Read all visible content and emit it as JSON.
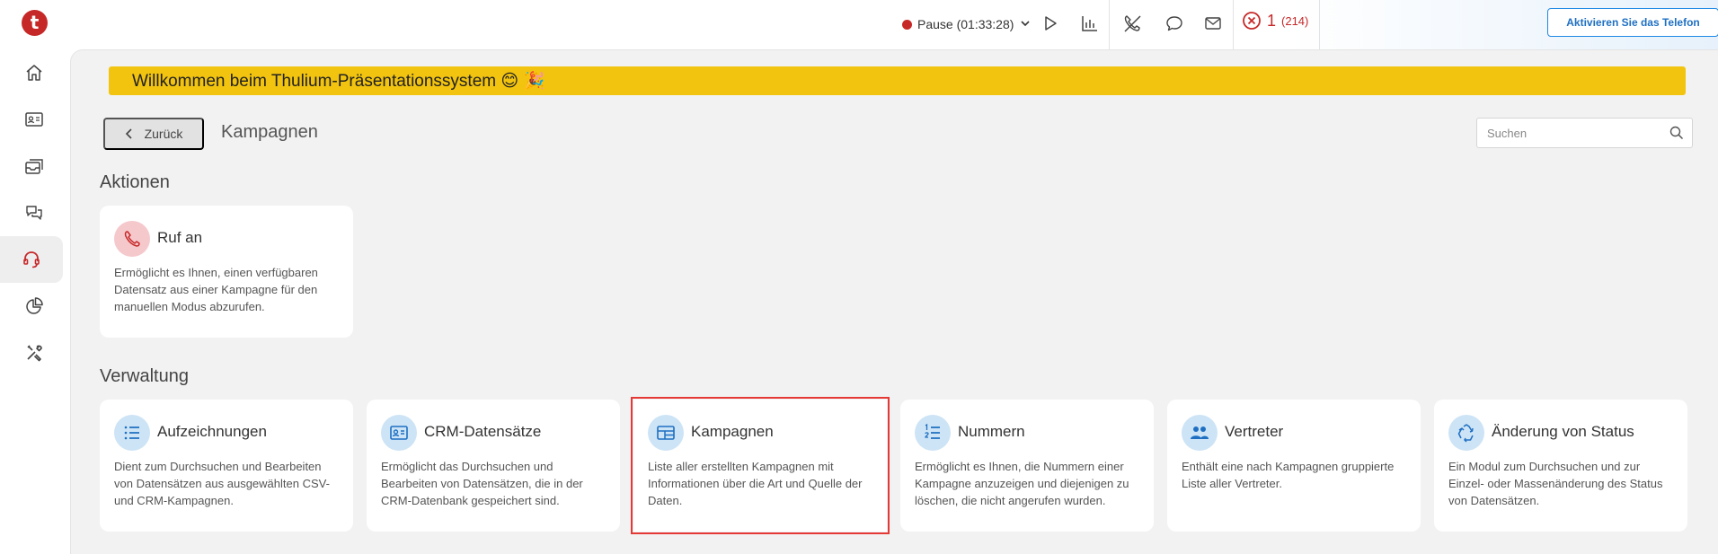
{
  "topbar": {
    "logo_letter": "t",
    "status_label": "Pause (01:33:28)",
    "error_count": "1",
    "error_total": "(214)",
    "activate_label": "Aktivieren Sie das Telefon"
  },
  "banner": {
    "text": "Willkommen beim Thulium-Präsentationssystem 😊 🎉"
  },
  "header": {
    "back_label": "Zurück",
    "title": "Kampagnen",
    "search_placeholder": "Suchen"
  },
  "sections": {
    "actions_title": "Aktionen",
    "management_title": "Verwaltung"
  },
  "actions": [
    {
      "title": "Ruf an",
      "desc": "Ermöglicht es Ihnen, einen verfügbaren Datensatz aus einer Kampagne für den manuellen Modus abzurufen.",
      "icon": "phone-icon"
    }
  ],
  "management": [
    {
      "title": "Aufzeichnungen",
      "desc": "Dient zum Durchsuchen und Bearbeiten von Datensätzen aus ausgewählten CSV- und CRM-Kampagnen.",
      "icon": "list-icon"
    },
    {
      "title": "CRM-Datensätze",
      "desc": "Ermöglicht das Durchsuchen und Bearbeiten von Datensätzen, die in der CRM-Datenbank gespeichert sind.",
      "icon": "contact-card-icon"
    },
    {
      "title": "Kampagnen",
      "desc": "Liste aller erstellten Kampagnen mit Informationen über die Art und Quelle der Daten.",
      "icon": "table-icon"
    },
    {
      "title": "Nummern",
      "desc": "Ermöglicht es Ihnen, die Nummern einer Kampagne anzuzeigen und diejenigen zu löschen, die nicht angerufen wurden.",
      "icon": "numbered-list-icon"
    },
    {
      "title": "Vertreter",
      "desc": "Enthält eine nach Kampagnen gruppierte Liste aller Vertreter.",
      "icon": "people-icon"
    },
    {
      "title": "Änderung von Status",
      "desc": "Ein Modul zum Durchsuchen und zur Einzel- oder Massenänderung des Status von Datensätzen.",
      "icon": "recycle-icon"
    }
  ],
  "colors": {
    "brand": "#c62828",
    "banner": "#f2c40f",
    "accent": "#1e88e5",
    "highlight": "#e53935"
  }
}
